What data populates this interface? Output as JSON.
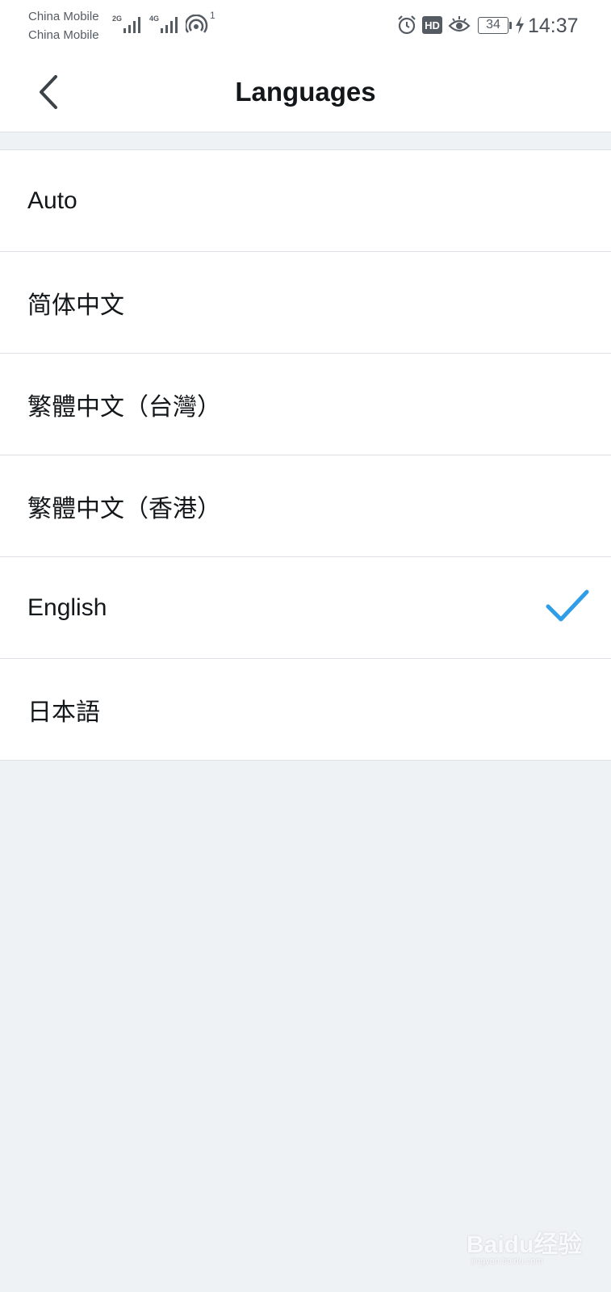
{
  "status_bar": {
    "carrier_1": "China Mobile",
    "carrier_2": "China Mobile",
    "sim1_network": "2G",
    "sim2_network": "4G",
    "hotspot_count": "1",
    "battery_level": "34",
    "time": "14:37",
    "icons": [
      "signal-icon",
      "hotspot-icon",
      "alarm-icon",
      "hd-icon",
      "eye-icon",
      "battery-icon",
      "charging-icon"
    ]
  },
  "header": {
    "title": "Languages",
    "back_icon": "chevron-left-icon"
  },
  "languages": [
    {
      "label": "Auto",
      "selected": false
    },
    {
      "label": "简体中文",
      "selected": false
    },
    {
      "label": "繁體中文（台灣）",
      "selected": false
    },
    {
      "label": "繁體中文（香港）",
      "selected": false
    },
    {
      "label": "English",
      "selected": true
    },
    {
      "label": "日本語",
      "selected": false
    }
  ],
  "colors": {
    "accent": "#2f9de8",
    "background": "#eff2f5",
    "text": "#14171a",
    "divider": "#dde1e5"
  },
  "watermark": {
    "brand": "Baidu经验",
    "domain": "jingyan.baidu.com"
  }
}
